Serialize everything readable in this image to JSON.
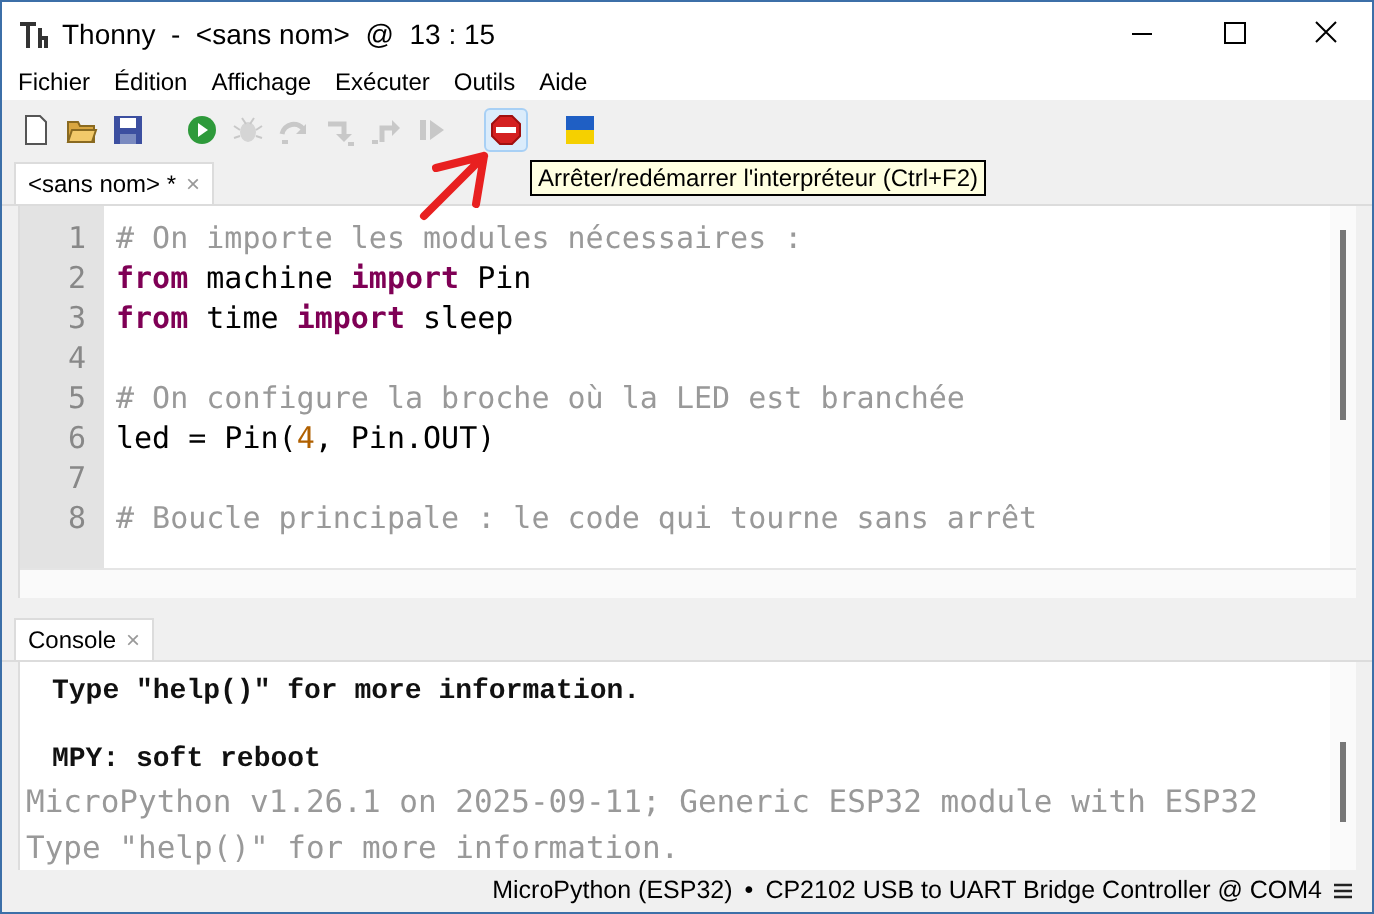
{
  "window": {
    "title": "Thonny  -  <sans nom>  @  13 : 15"
  },
  "menu": [
    {
      "label": "Fichier"
    },
    {
      "label": "Édition"
    },
    {
      "label": "Affichage"
    },
    {
      "label": "Exécuter"
    },
    {
      "label": "Outils"
    },
    {
      "label": "Aide"
    }
  ],
  "toolbar": [
    {
      "kind": "new",
      "disabled": false,
      "highlighted": false
    },
    {
      "kind": "open",
      "disabled": false,
      "highlighted": false
    },
    {
      "kind": "save",
      "disabled": false,
      "highlighted": false
    },
    {
      "kind": "run",
      "disabled": false,
      "highlighted": false
    },
    {
      "kind": "debug",
      "disabled": true,
      "highlighted": false
    },
    {
      "kind": "step-over",
      "disabled": true,
      "highlighted": false
    },
    {
      "kind": "step-into",
      "disabled": true,
      "highlighted": false
    },
    {
      "kind": "step-out",
      "disabled": true,
      "highlighted": false
    },
    {
      "kind": "resume",
      "disabled": true,
      "highlighted": false
    },
    {
      "kind": "stop",
      "disabled": false,
      "highlighted": true
    },
    {
      "kind": "flag",
      "disabled": false,
      "highlighted": false
    }
  ],
  "tooltip": "Arrêter/redémarrer l'interpréteur (Ctrl+F2)",
  "editor": {
    "tab": {
      "label": "<sans nom> *",
      "close": "×",
      "selected": true
    },
    "lines": [
      {
        "number": "1",
        "tokens": [
          {
            "kind": "comment",
            "text": "# On importe les modules nécessaires :"
          }
        ]
      },
      {
        "number": "2",
        "tokens": [
          {
            "kind": "keyword",
            "text": "from"
          },
          {
            "kind": "name",
            "text": " machine "
          },
          {
            "kind": "keyword",
            "text": "import"
          },
          {
            "kind": "name",
            "text": " Pin"
          }
        ]
      },
      {
        "number": "3",
        "tokens": [
          {
            "kind": "keyword",
            "text": "from"
          },
          {
            "kind": "name",
            "text": " time "
          },
          {
            "kind": "keyword",
            "text": "import"
          },
          {
            "kind": "name",
            "text": " sleep"
          }
        ]
      },
      {
        "number": "4"
      },
      {
        "number": "5",
        "tokens": [
          {
            "kind": "comment",
            "text": "# On configure la broche où la LED est branchée"
          }
        ]
      },
      {
        "number": "6",
        "tokens": [
          {
            "kind": "name",
            "text": "led = Pin("
          },
          {
            "kind": "number",
            "text": "4"
          },
          {
            "kind": "name",
            "text": ", Pin.OUT)"
          }
        ]
      },
      {
        "number": "7"
      },
      {
        "number": "8",
        "tokens": [
          {
            "kind": "comment",
            "text": "# Boucle principale : le code qui tourne sans arrêt"
          }
        ]
      }
    ]
  },
  "console": {
    "tab": {
      "label": "Console",
      "close": "×",
      "selected": true
    },
    "lines": [
      {
        "kind": "output",
        "text": "Type \"help()\" for more information."
      },
      {
        "kind": "blank"
      },
      {
        "kind": "output",
        "text": "MPY: soft reboot"
      },
      {
        "kind": "banner",
        "text": "MicroPython v1.26.1 on 2025-09-11; Generic ESP32 module with ESP32"
      },
      {
        "kind": "banner",
        "text": "Type \"help()\" for more information."
      }
    ]
  },
  "status_bar": {
    "interpreter": "MicroPython (ESP32)",
    "separator": "•",
    "port": "CP2102 USB to UART Bridge Controller @ COM4"
  }
}
